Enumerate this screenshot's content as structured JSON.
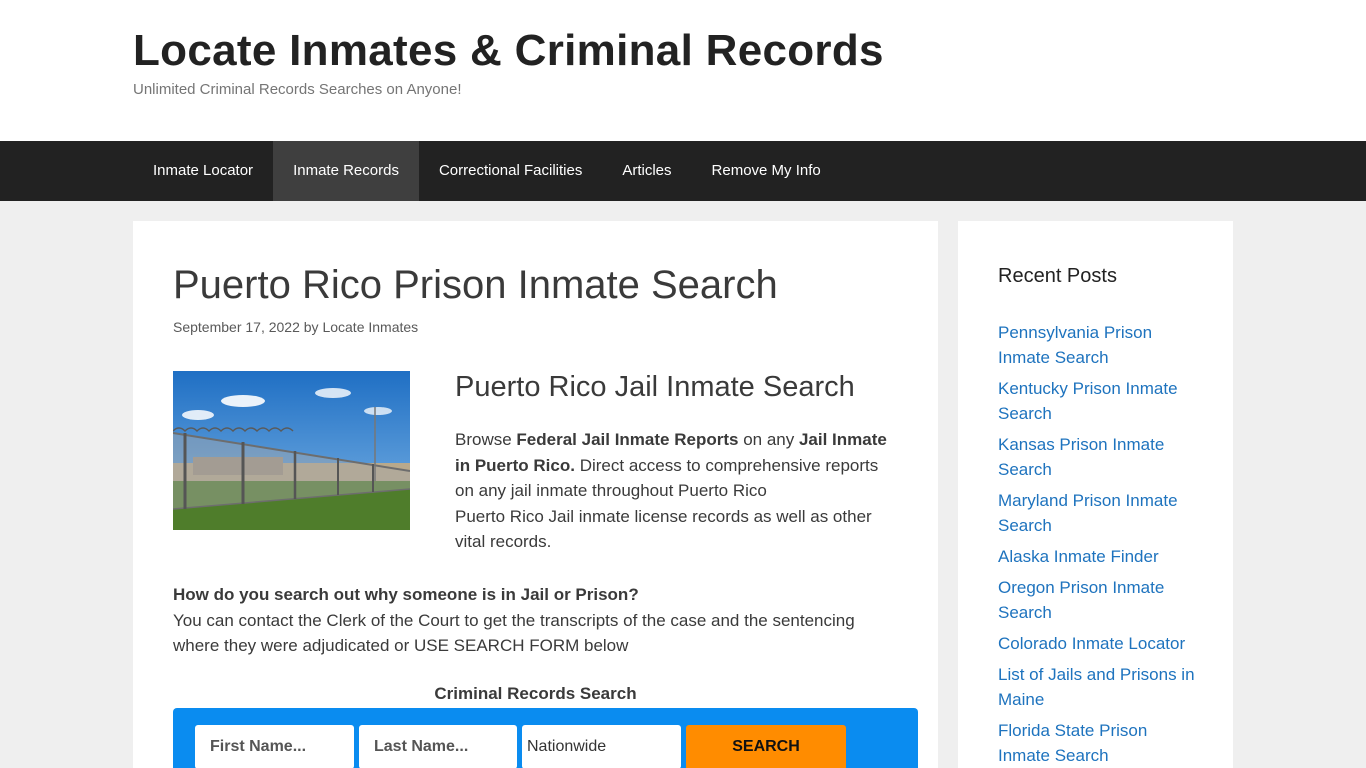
{
  "header": {
    "site_title": "Locate Inmates & Criminal Records",
    "tagline": "Unlimited Criminal Records Searches on Anyone!"
  },
  "nav": {
    "items": [
      {
        "label": "Inmate Locator"
      },
      {
        "label": "Inmate Records"
      },
      {
        "label": "Correctional Facilities"
      },
      {
        "label": "Articles"
      },
      {
        "label": "Remove My Info"
      }
    ],
    "active": "Inmate Records"
  },
  "article": {
    "title": "Puerto Rico Prison Inmate Search",
    "date": "September 17, 2022",
    "by": "by",
    "author": "Locate Inmates",
    "image_alt": "prison fence with razor wire",
    "section_heading": "Puerto Rico Jail Inmate Search",
    "intro": {
      "browse": "Browse",
      "bold1": "Federal Jail Inmate Reports",
      "on_any": "on any",
      "bold2": "Jail Inmate in Puerto Rico.",
      "rest1": "Direct access to comprehensive reports on any jail inmate throughout Puerto Rico",
      "rest2": "Puerto Rico Jail inmate license records as well as other vital records."
    },
    "question_title": "How do you search out why someone is in Jail or Prison?",
    "question_body": "You can contact the Clerk of the Court to get the transcripts of the case and the sentencing where they were adjudicated or USE SEARCH FORM below"
  },
  "search_form": {
    "caption": "Criminal Records Search",
    "first_name_placeholder": "First Name...",
    "last_name_placeholder": "Last Name...",
    "state_value": "Nationwide",
    "button_label": "SEARCH"
  },
  "sidebar": {
    "widget_title": "Recent Posts",
    "posts": [
      {
        "label": "Pennsylvania Prison Inmate Search"
      },
      {
        "label": "Kentucky Prison Inmate Search"
      },
      {
        "label": "Kansas Prison Inmate Search"
      },
      {
        "label": "Maryland Prison Inmate Search"
      },
      {
        "label": "Alaska Inmate Finder"
      },
      {
        "label": "Oregon Prison Inmate Search"
      },
      {
        "label": "Colorado Inmate Locator"
      },
      {
        "label": "List of Jails and Prisons in Maine"
      },
      {
        "label": "Florida State Prison Inmate Search"
      }
    ]
  },
  "colors": {
    "nav_bg": "#222222",
    "nav_active_bg": "#3f3f3f",
    "link": "#1e73be",
    "search_box": "#0a8cf0",
    "search_button": "#ff8c00"
  }
}
